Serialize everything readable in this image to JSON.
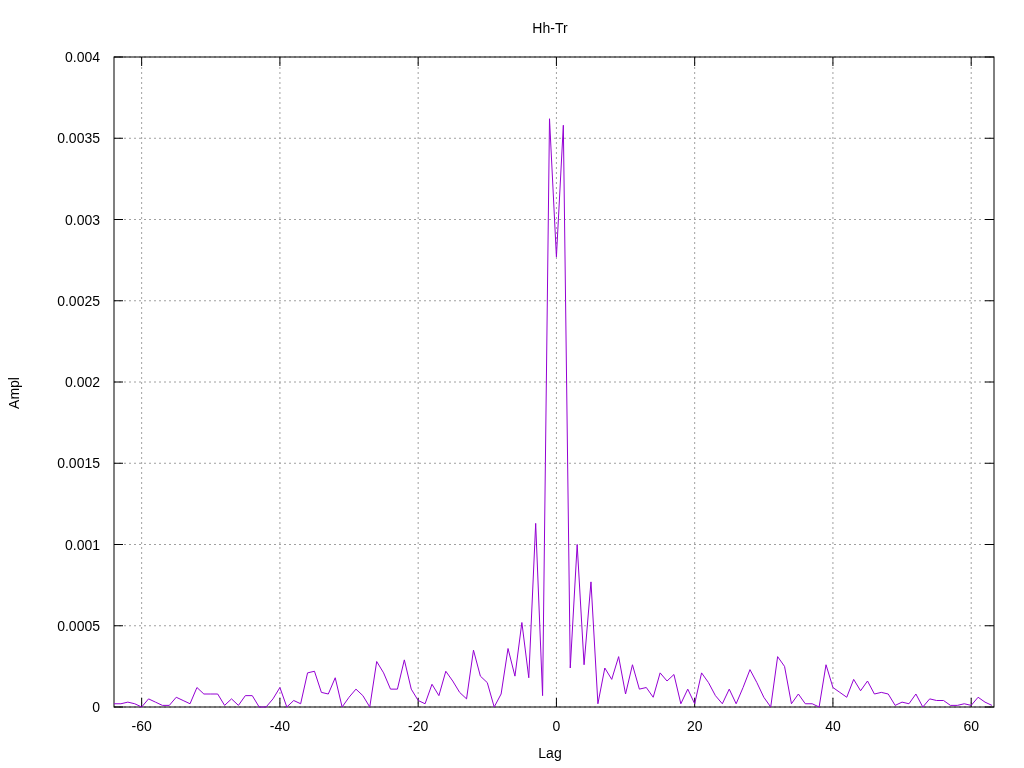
{
  "chart": {
    "chart_data": {
      "type": "line",
      "title": "Hh-Tr",
      "xlabel": "Lag",
      "ylabel": "Ampl",
      "xlim": [
        -64,
        63.3
      ],
      "ylim": [
        0,
        0.004
      ],
      "grid": true,
      "xticks": [
        -60,
        -40,
        -20,
        0,
        20,
        40,
        60
      ],
      "yticks": [
        {
          "value": 0,
          "label": "0"
        },
        {
          "value": 0.0005,
          "label": "0.0005"
        },
        {
          "value": 0.001,
          "label": "0.001"
        },
        {
          "value": 0.0015,
          "label": "0.0015"
        },
        {
          "value": 0.002,
          "label": "0.002"
        },
        {
          "value": 0.0025,
          "label": "0.0025"
        },
        {
          "value": 0.003,
          "label": "0.003"
        },
        {
          "value": 0.0035,
          "label": "0.0035"
        },
        {
          "value": 0.004,
          "label": "0.004"
        }
      ],
      "x": [
        -64,
        -63,
        -62,
        -61,
        -60,
        -59,
        -58,
        -57,
        -56,
        -55,
        -54,
        -53,
        -52,
        -51,
        -50,
        -49,
        -48,
        -47,
        -46,
        -45,
        -44,
        -43,
        -42,
        -41,
        -40,
        -39,
        -38,
        -37,
        -36,
        -35,
        -34,
        -33,
        -32,
        -31,
        -30,
        -29,
        -28,
        -27,
        -26,
        -25,
        -24,
        -23,
        -22,
        -21,
        -20,
        -19,
        -18,
        -17,
        -16,
        -15,
        -14,
        -13,
        -12,
        -11,
        -10,
        -9,
        -8,
        -7,
        -6,
        -5,
        -4,
        -3,
        -2,
        -1,
        0,
        1,
        2,
        3,
        4,
        5,
        6,
        7,
        8,
        9,
        10,
        11,
        12,
        13,
        14,
        15,
        16,
        17,
        18,
        19,
        20,
        21,
        22,
        23,
        24,
        25,
        26,
        27,
        28,
        29,
        30,
        31,
        32,
        33,
        34,
        35,
        36,
        37,
        38,
        39,
        40,
        41,
        42,
        43,
        44,
        45,
        46,
        47,
        48,
        49,
        50,
        51,
        52,
        53,
        54,
        55,
        56,
        57,
        58,
        59,
        60,
        61,
        62,
        63
      ],
      "series": [
        {
          "color": "#9400d3",
          "values": [
            2e-05,
            2e-05,
            3e-05,
            2e-05,
            0,
            5e-05,
            3e-05,
            1e-05,
            1e-05,
            6e-05,
            4e-05,
            2e-05,
            0.00012,
            8e-05,
            8e-05,
            8e-05,
            1e-05,
            5e-05,
            1e-05,
            7e-05,
            7e-05,
            0,
            0,
            5e-05,
            0.00012,
            0,
            4e-05,
            2e-05,
            0.00021,
            0.00022,
            9e-05,
            8e-05,
            0.00018,
            0,
            6e-05,
            0.00011,
            7e-05,
            0,
            0.00028,
            0.00021,
            0.00011,
            0.00011,
            0.00029,
            0.00011,
            4e-05,
            2e-05,
            0.00014,
            7e-05,
            0.00022,
            0.00016,
            9e-05,
            5e-05,
            0.00035,
            0.00019,
            0.00015,
            0,
            8e-05,
            0.00036,
            0.00019,
            0.00052,
            0.00018,
            0.00113,
            7e-05,
            0.00362,
            0.00277,
            0.00358,
            0.00024,
            0.001,
            0.00026,
            0.00077,
            2e-05,
            0.00024,
            0.00017,
            0.00031,
            8e-05,
            0.00026,
            0.00011,
            0.00012,
            6e-05,
            0.00021,
            0.00016,
            0.0002,
            2e-05,
            0.00011,
            2e-05,
            0.00021,
            0.00015,
            7e-05,
            2e-05,
            0.00011,
            2e-05,
            0.00012,
            0.00023,
            0.00015,
            6e-05,
            0,
            0.00031,
            0.00025,
            2e-05,
            8e-05,
            2e-05,
            2e-05,
            0,
            0.00026,
            0.00012,
            9e-05,
            6e-05,
            0.00017,
            0.0001,
            0.00016,
            8e-05,
            9e-05,
            8e-05,
            1e-05,
            3e-05,
            2e-05,
            8e-05,
            0,
            5e-05,
            4e-05,
            4e-05,
            1e-05,
            1e-05,
            2e-05,
            1e-05,
            6e-05,
            3e-05,
            1e-05
          ]
        }
      ]
    }
  }
}
